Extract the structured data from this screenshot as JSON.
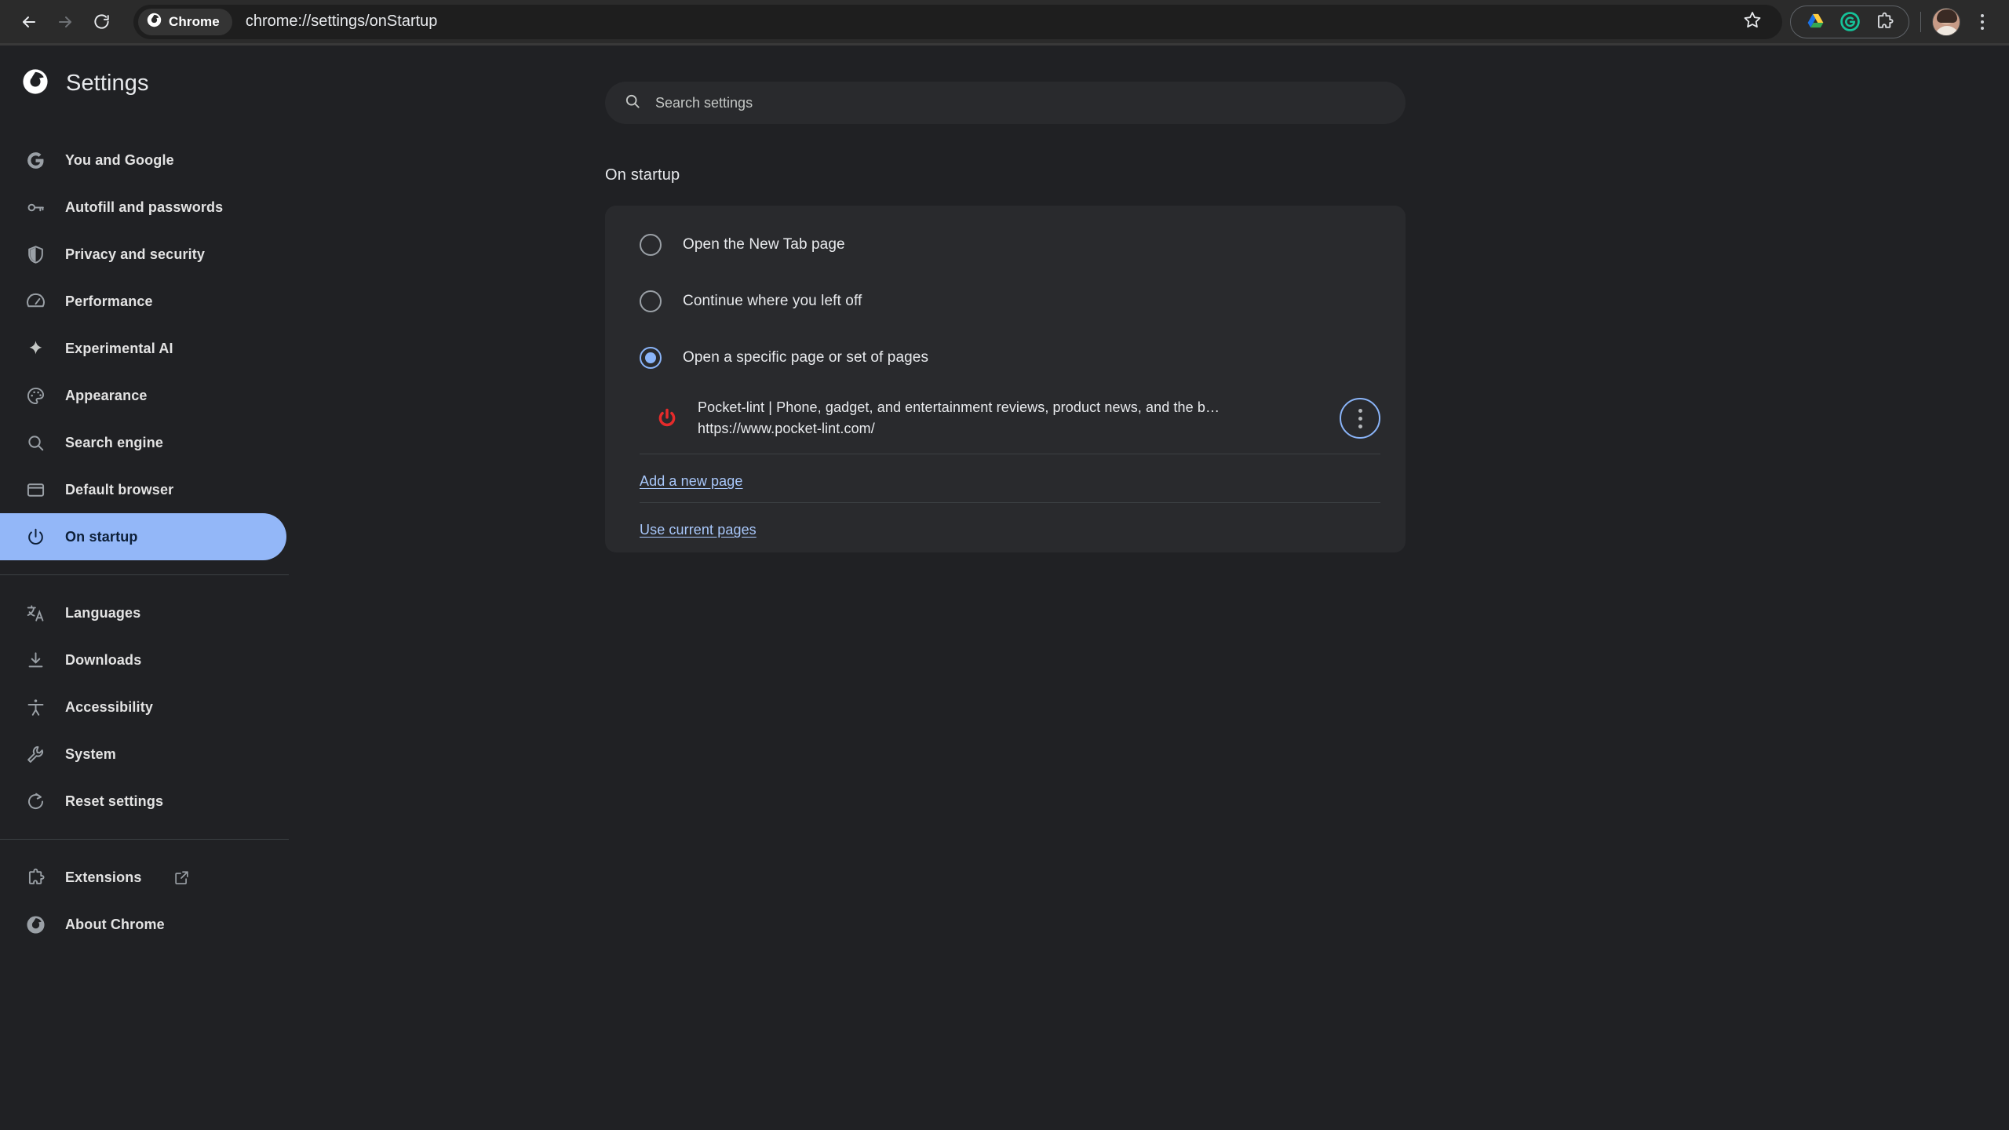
{
  "browser": {
    "back_icon": "back-arrow-icon",
    "forward_icon": "forward-arrow-icon",
    "reload_icon": "reload-icon",
    "chip_label": "Chrome",
    "url": "chrome://settings/onStartup",
    "bookmark_icon": "star-icon",
    "toolbar_extensions": [
      {
        "name": "google-drive-icon",
        "color": "#4285f4"
      },
      {
        "name": "grammarly-icon",
        "color": "#15c39a"
      },
      {
        "name": "extensions-puzzle-icon",
        "color": "#c4c7c5"
      }
    ],
    "profile_avatar": "avatar",
    "menu_icon": "three-dot-menu-icon"
  },
  "sidebar": {
    "logo": "chrome-logo-icon",
    "title": "Settings",
    "groups": [
      {
        "items": [
          {
            "label": "You and Google",
            "icon": "google-g-icon",
            "active": false
          },
          {
            "label": "Autofill and passwords",
            "icon": "key-icon",
            "active": false
          },
          {
            "label": "Privacy and security",
            "icon": "shield-icon",
            "active": false
          },
          {
            "label": "Performance",
            "icon": "speedometer-icon",
            "active": false
          },
          {
            "label": "Experimental AI",
            "icon": "sparkle-icon",
            "active": false
          },
          {
            "label": "Appearance",
            "icon": "palette-icon",
            "active": false
          },
          {
            "label": "Search engine",
            "icon": "search-icon",
            "active": false
          },
          {
            "label": "Default browser",
            "icon": "browser-window-icon",
            "active": false
          },
          {
            "label": "On startup",
            "icon": "power-icon",
            "active": true
          }
        ]
      },
      {
        "items": [
          {
            "label": "Languages",
            "icon": "translate-icon",
            "active": false
          },
          {
            "label": "Downloads",
            "icon": "download-icon",
            "active": false
          },
          {
            "label": "Accessibility",
            "icon": "accessibility-icon",
            "active": false
          },
          {
            "label": "System",
            "icon": "wrench-icon",
            "active": false
          },
          {
            "label": "Reset settings",
            "icon": "reset-icon",
            "active": false
          }
        ]
      },
      {
        "items": [
          {
            "label": "Extensions",
            "icon": "puzzle-icon",
            "active": false,
            "external": true,
            "external_icon": "open-in-new-icon"
          },
          {
            "label": "About Chrome",
            "icon": "chrome-logo-icon",
            "active": false
          }
        ]
      }
    ]
  },
  "search": {
    "icon": "search-icon",
    "placeholder": "Search settings",
    "value": ""
  },
  "main": {
    "section_title": "On startup",
    "options": [
      {
        "label": "Open the New Tab page",
        "selected": false
      },
      {
        "label": "Continue where you left off",
        "selected": false
      },
      {
        "label": "Open a specific page or set of pages",
        "selected": true
      }
    ],
    "startup_pages": [
      {
        "favicon": "pocket-lint-power-icon",
        "favicon_color": "#e62b2b",
        "title": "Pocket-lint | Phone, gadget, and entertainment reviews, product news, and the b…",
        "url": "https://www.pocket-lint.com/",
        "menu_icon": "three-dot-menu-icon"
      }
    ],
    "add_page_link": "Add a new page",
    "use_current_link": "Use current pages"
  },
  "colors": {
    "accent_blue": "#8ab4f8",
    "link_blue": "#a8c7fa",
    "active_pill": "#93b7f8",
    "page_bg": "#202124",
    "card_bg": "#292a2d",
    "toolbar_bg": "#2b2b2b"
  }
}
